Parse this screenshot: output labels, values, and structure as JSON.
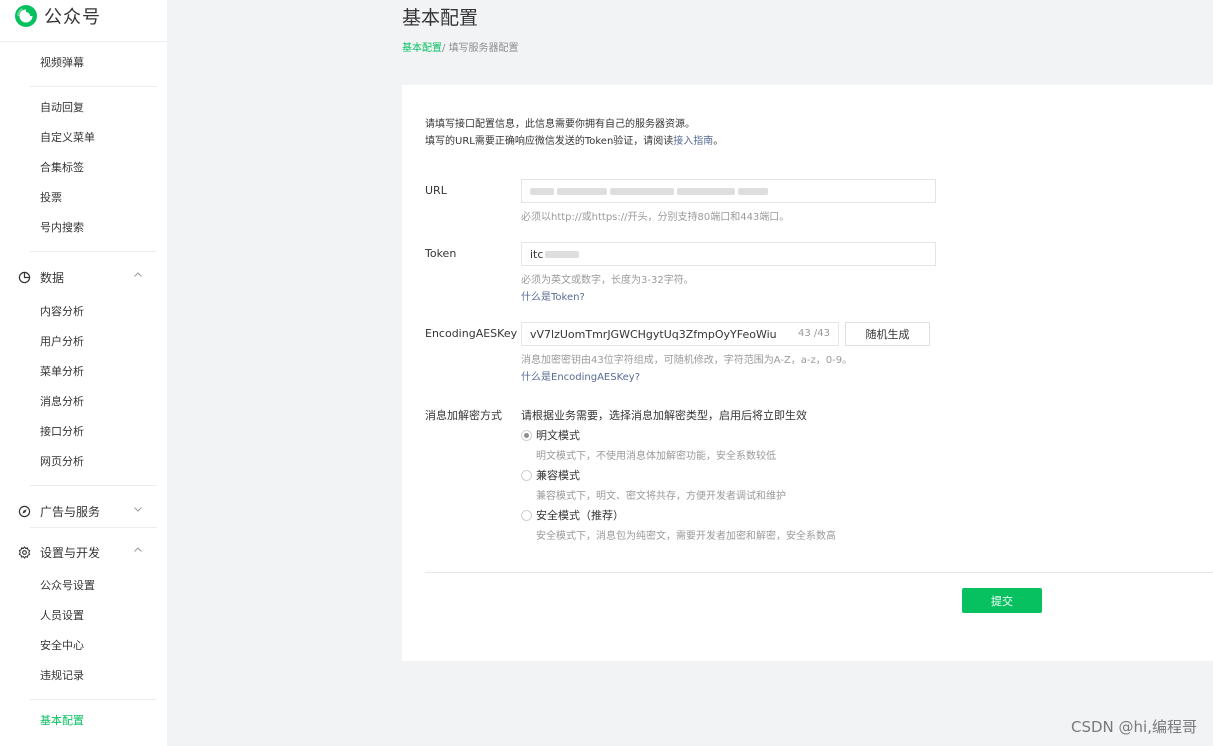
{
  "sidebar": {
    "brand": "公众号",
    "items_top": [
      "视频弹幕"
    ],
    "items_content": [
      "自动回复",
      "自定义菜单",
      "合集标签",
      "投票",
      "号内搜索"
    ],
    "group_data": "数据",
    "items_data": [
      "内容分析",
      "用户分析",
      "菜单分析",
      "消息分析",
      "接口分析",
      "网页分析"
    ],
    "group_ads": "广告与服务",
    "group_settings": "设置与开发",
    "items_settings": [
      "公众号设置",
      "人员设置",
      "安全中心",
      "违规记录"
    ],
    "active_item": "基本配置"
  },
  "header": {
    "title": "基本配置",
    "breadcrumb_link": "基本配置",
    "breadcrumb_sep": "/ ",
    "breadcrumb_current": "填写服务器配置"
  },
  "form": {
    "intro_line1": "请填写接口配置信息，此信息需要你拥有自己的服务器资源。",
    "intro_line2_prefix": "填写的URL需要正确响应微信发送的Token验证，请阅读",
    "intro_link": "接入指南",
    "intro_line2_suffix": "。",
    "url_label": "URL",
    "url_hint": "必须以http://或https://开头，分别支持80端口和443端口。",
    "token_label": "Token",
    "token_value": "itc",
    "token_hint": "必须为英文或数字，长度为3-32字符。",
    "token_link": "什么是Token?",
    "aes_label": "EncodingAESKey",
    "aes_value": "vV7lzUomTmrJGWCHgytUq3ZfmpOyYFeoWiu",
    "aes_count": "43 /43",
    "aes_button": "随机生成",
    "aes_hint": "消息加密密钥由43位字符组成，可随机修改，字符范围为A-Z，a-z，0-9。",
    "aes_link": "什么是EncodingAESKey?",
    "mode_label": "消息加解密方式",
    "mode_intro": "请根据业务需要，选择消息加解密类型，启用后将立即生效",
    "modes": [
      {
        "label": "明文模式",
        "desc": "明文模式下，不使用消息体加解密功能，安全系数较低",
        "checked": true
      },
      {
        "label": "兼容模式",
        "desc": "兼容模式下，明文、密文将共存，方便开发者调试和维护",
        "checked": false
      },
      {
        "label": "安全模式（推荐）",
        "desc": "安全模式下，消息包为纯密文，需要开发者加密和解密，安全系数高",
        "checked": false
      }
    ],
    "submit": "提交"
  },
  "watermark": "CSDN @hi,编程哥",
  "colors": {
    "brand_green": "#07c160",
    "link_blue": "#576b95",
    "page_bg": "#f2f3f5"
  }
}
